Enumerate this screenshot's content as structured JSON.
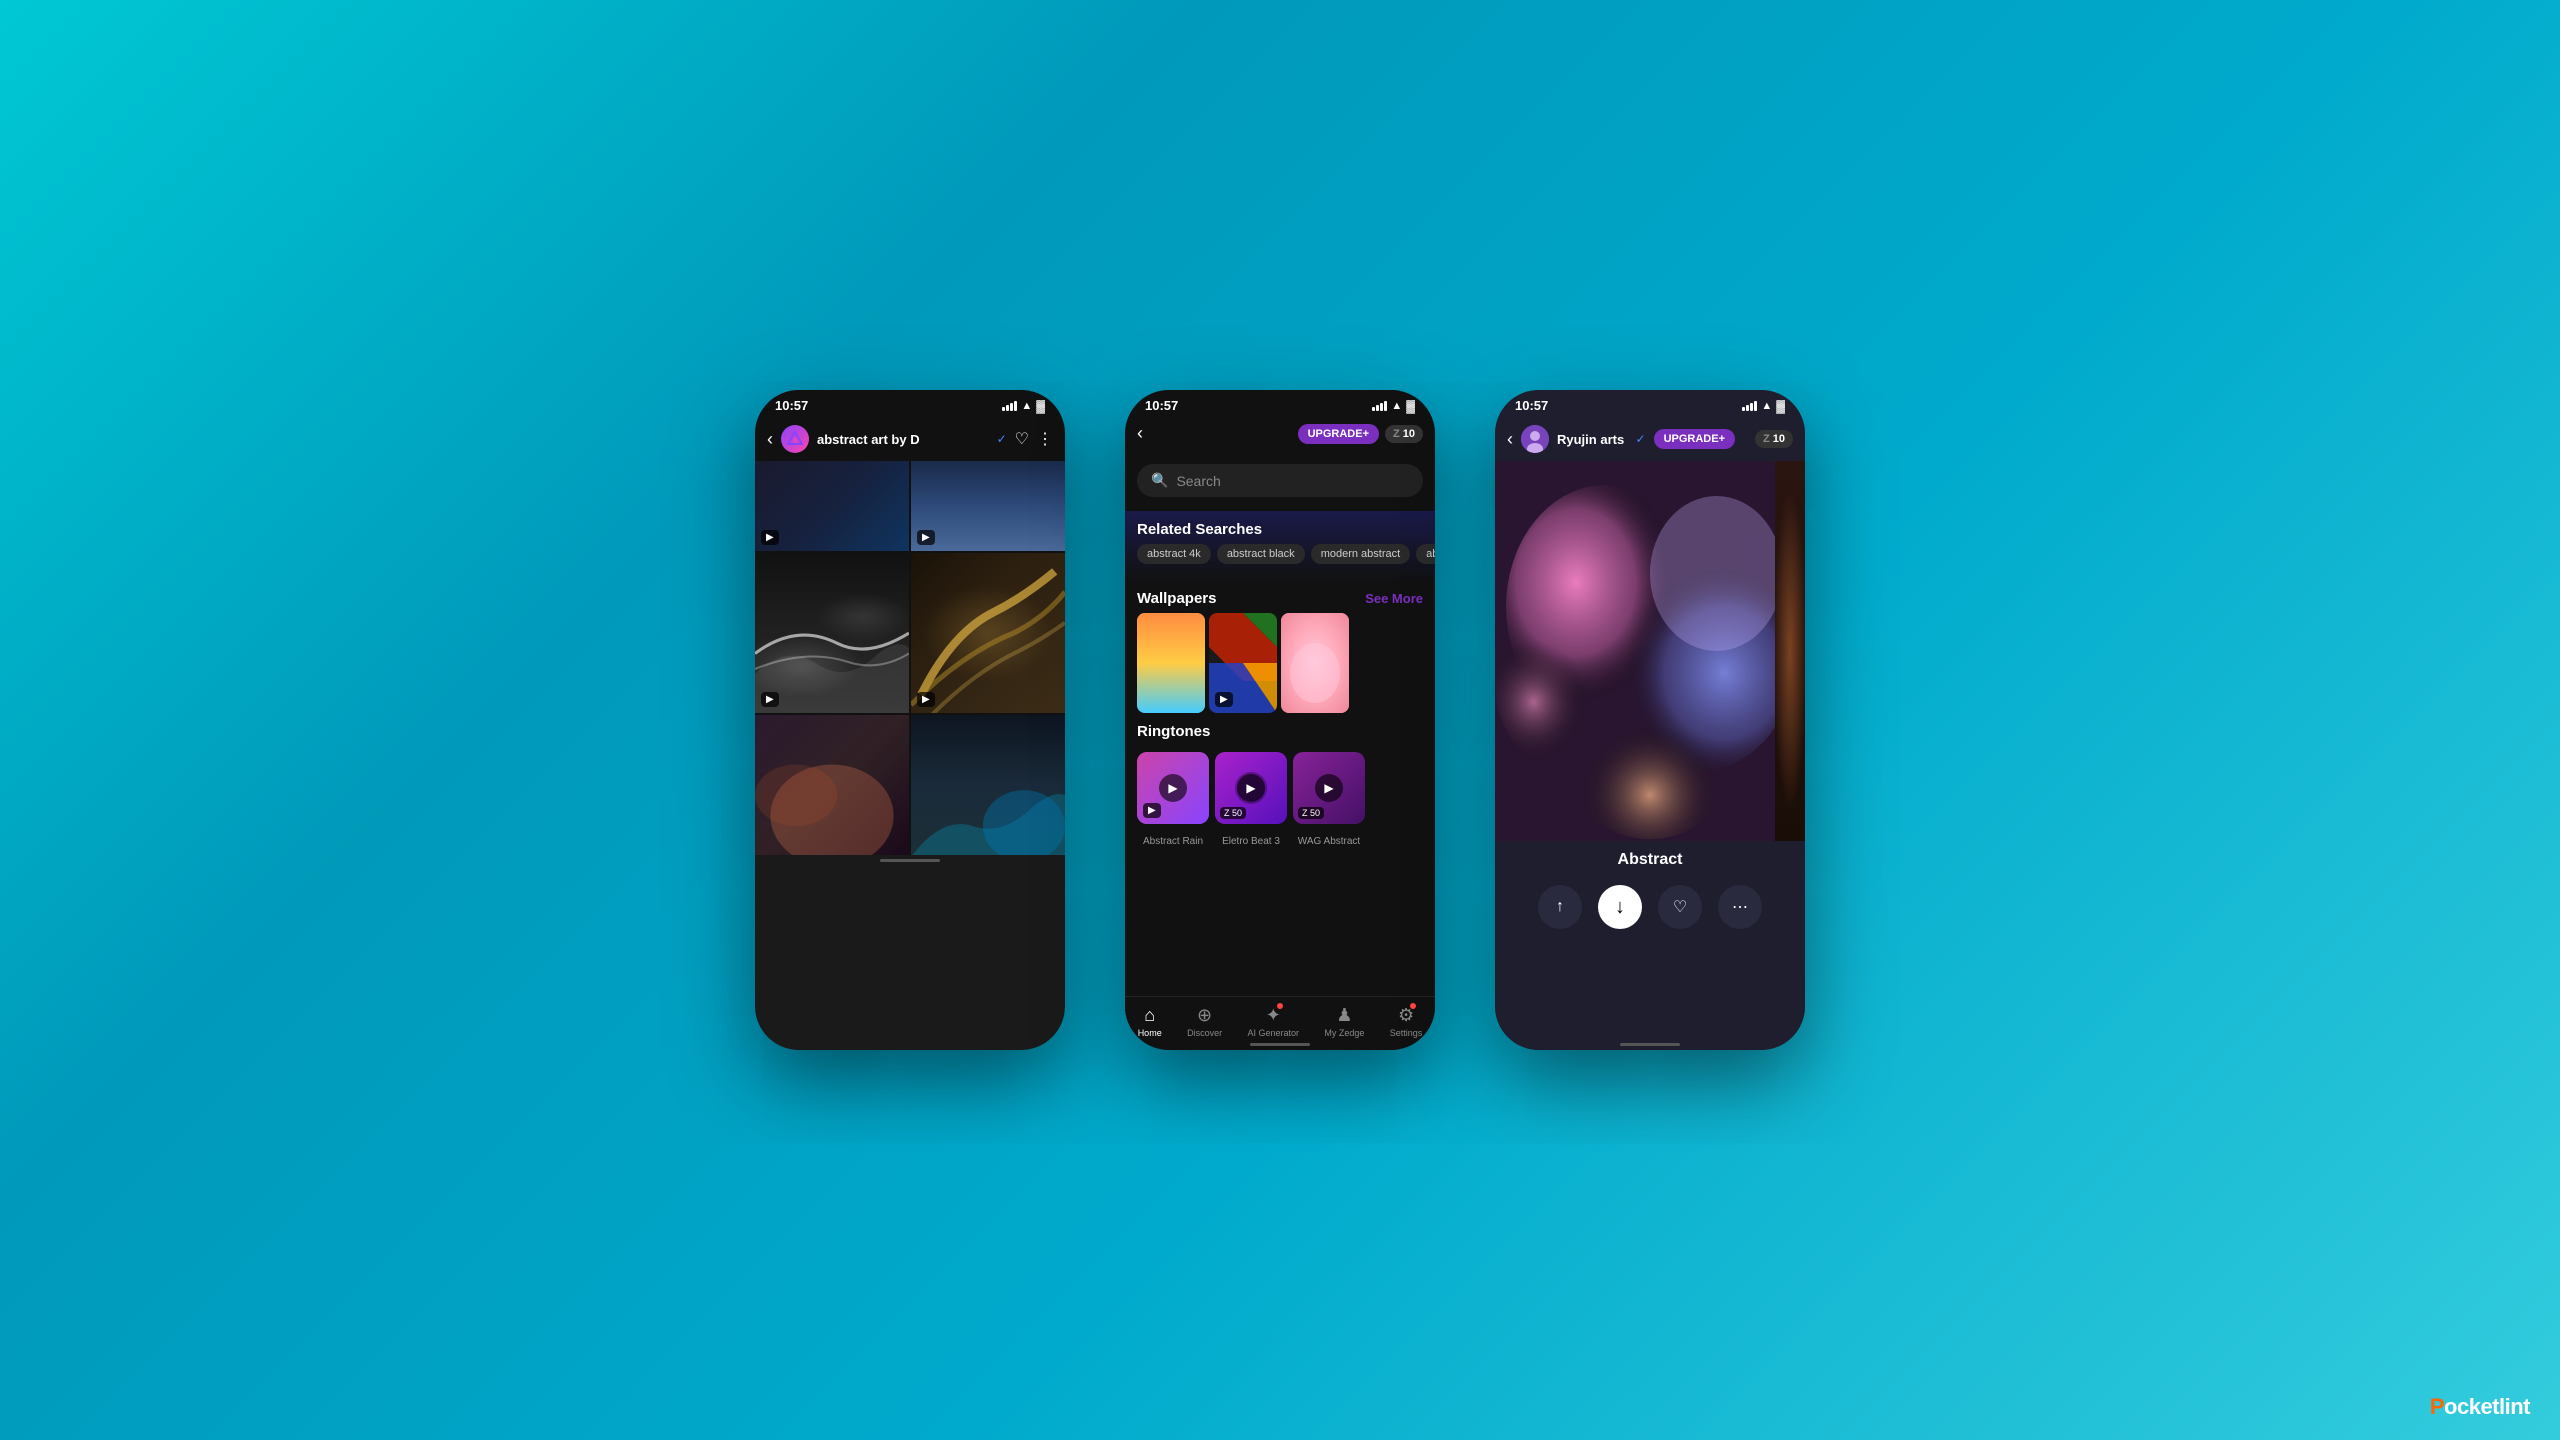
{
  "background": {
    "gradient_start": "#00c8d4",
    "gradient_end": "#33ccdd"
  },
  "phones": {
    "left": {
      "status_bar": {
        "time": "10:57",
        "signal": "strong",
        "wifi": true,
        "battery": "full"
      },
      "header": {
        "back_label": "‹",
        "channel_name": "abstract art by D",
        "verified": true,
        "heart_label": "♡",
        "more_label": "⋮"
      },
      "gallery_items": [
        {
          "type": "video",
          "row": 1,
          "col": 1
        },
        {
          "type": "video",
          "row": 1,
          "col": 2
        },
        {
          "type": "video",
          "row": 2,
          "col": 1
        },
        {
          "type": "video",
          "row": 2,
          "col": 2
        },
        {
          "type": "image",
          "row": 3,
          "col": 1
        },
        {
          "type": "image",
          "row": 3,
          "col": 2
        }
      ]
    },
    "center": {
      "status_bar": {
        "time": "10:57"
      },
      "header": {
        "back_label": "‹",
        "upgrade_label": "UPGRADE+",
        "credit_label": "Z 10"
      },
      "search": {
        "placeholder": "Search"
      },
      "related_searches": {
        "title": "Related Searches",
        "tags": [
          "abstract 4k",
          "abstract black",
          "modern abstract",
          "abs..."
        ]
      },
      "wallpapers": {
        "title": "Wallpapers",
        "see_more": "See More",
        "items": [
          {
            "label": "gradient sunset"
          },
          {
            "label": "geometric color"
          },
          {
            "label": "pink clouds"
          }
        ]
      },
      "ringtones": {
        "title": "Ringtones",
        "items": [
          {
            "name": "Abstract Rain",
            "price": ""
          },
          {
            "name": "Eletro Beat 3",
            "price": "Z 50"
          },
          {
            "name": "WAG Abstract",
            "price": "Z 50"
          }
        ]
      },
      "bottom_nav": {
        "items": [
          {
            "icon": "⌂",
            "label": "Home",
            "active": true
          },
          {
            "icon": "⊕",
            "label": "Discover",
            "active": false
          },
          {
            "icon": "✦",
            "label": "AI Generator",
            "active": false,
            "dot": true
          },
          {
            "icon": "♟",
            "label": "My Zedge",
            "active": false
          },
          {
            "icon": "⚙",
            "label": "Settings",
            "active": false,
            "dot": true
          }
        ]
      }
    },
    "right": {
      "status_bar": {
        "time": "10:57"
      },
      "header": {
        "back_label": "‹",
        "channel_name": "Ryujin arts",
        "verified": true,
        "upgrade_label": "UPGRADE+",
        "credit_label": "Z 10"
      },
      "wallpaper": {
        "title": "Abstract"
      },
      "actions": {
        "share_label": "↑",
        "download_label": "↓",
        "heart_label": "♡",
        "more_label": "⋯"
      }
    }
  },
  "watermark": {
    "text_main": "ocketlint",
    "text_p": "P",
    "full": "Pocketlint"
  }
}
